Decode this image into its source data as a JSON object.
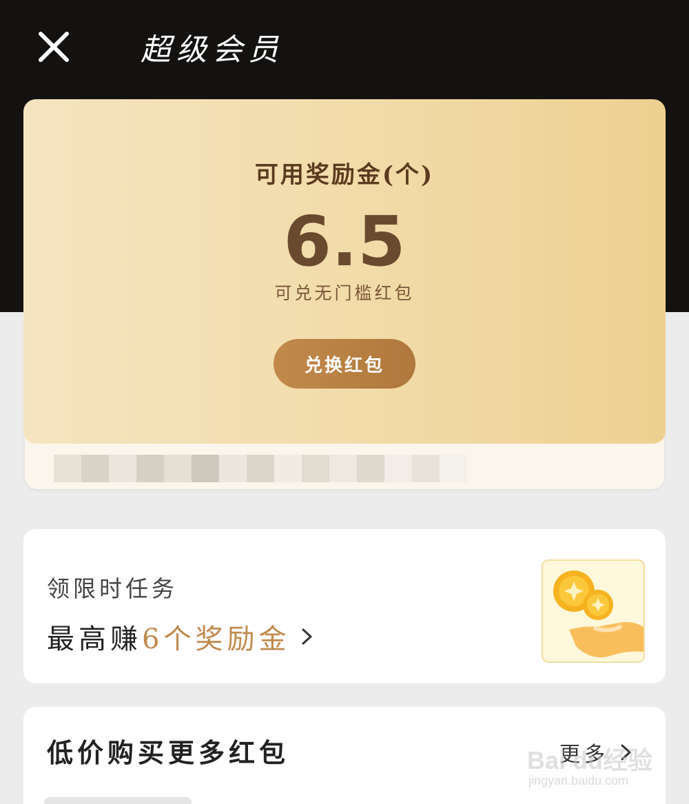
{
  "header": {
    "title": "超级会员",
    "close_icon": "close-icon"
  },
  "reward": {
    "title": "可用奖励金(个)",
    "value": "6.5",
    "note": "可兑无门槛红包",
    "exchange_label": "兑换红包"
  },
  "task": {
    "title": "领限时任务",
    "desc_prefix": "最高赚",
    "desc_highlight": "6个奖励金",
    "image_icon": "coins-hand-icon"
  },
  "buy": {
    "title": "低价购买更多红包",
    "more_label": "更多"
  },
  "watermark": {
    "main": "Bai du经验",
    "sub": "jingyan.baidu.com"
  },
  "colors": {
    "header_bg": "#141210",
    "card_gold": "#f1dba8",
    "accent_brown": "#c08a4c",
    "button_brown": "#b9813f"
  }
}
